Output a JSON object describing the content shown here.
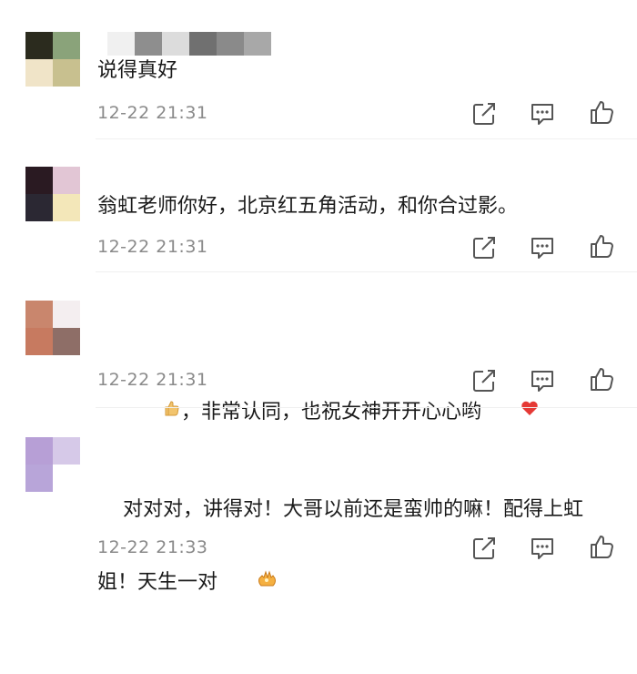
{
  "comments": [
    {
      "text": "说得真好",
      "time": "12-22 21:31",
      "avatar": [
        "#2b2b1e",
        "#8aa37a",
        "#f0e4c8",
        "#c8c08f"
      ]
    },
    {
      "text": "翁虹老师你好，北京红五角活动，和你合过影。",
      "time": "12-22 21:31",
      "avatar": [
        "#2a1a22",
        "#e2c6d5",
        "#2b2833",
        "#f3e7b9"
      ]
    },
    {
      "text_before": "",
      "text": "，非常认同，也祝女神开开心心哟",
      "time": "12-22 21:31",
      "avatar": [
        "#c9866d",
        "#f4eef0",
        "#c77a60",
        "#8e6e67"
      ],
      "lead_emoji": "thumbs-up-emoji",
      "tail_emoji": "red-heart-emoji"
    },
    {
      "text": "对对对，讲得对！大哥以前还是蛮帅的嘛！配得上虹姐！天生一对",
      "time": "12-22 21:33",
      "avatar": [
        "#b79fd6",
        "#d6c9e8",
        "#b8a5d9",
        "#ffffff"
      ],
      "tail_emoji": "ok-hand-emoji"
    }
  ],
  "icons": {
    "share": "share-icon",
    "reply": "reply-icon",
    "like": "like-icon"
  }
}
